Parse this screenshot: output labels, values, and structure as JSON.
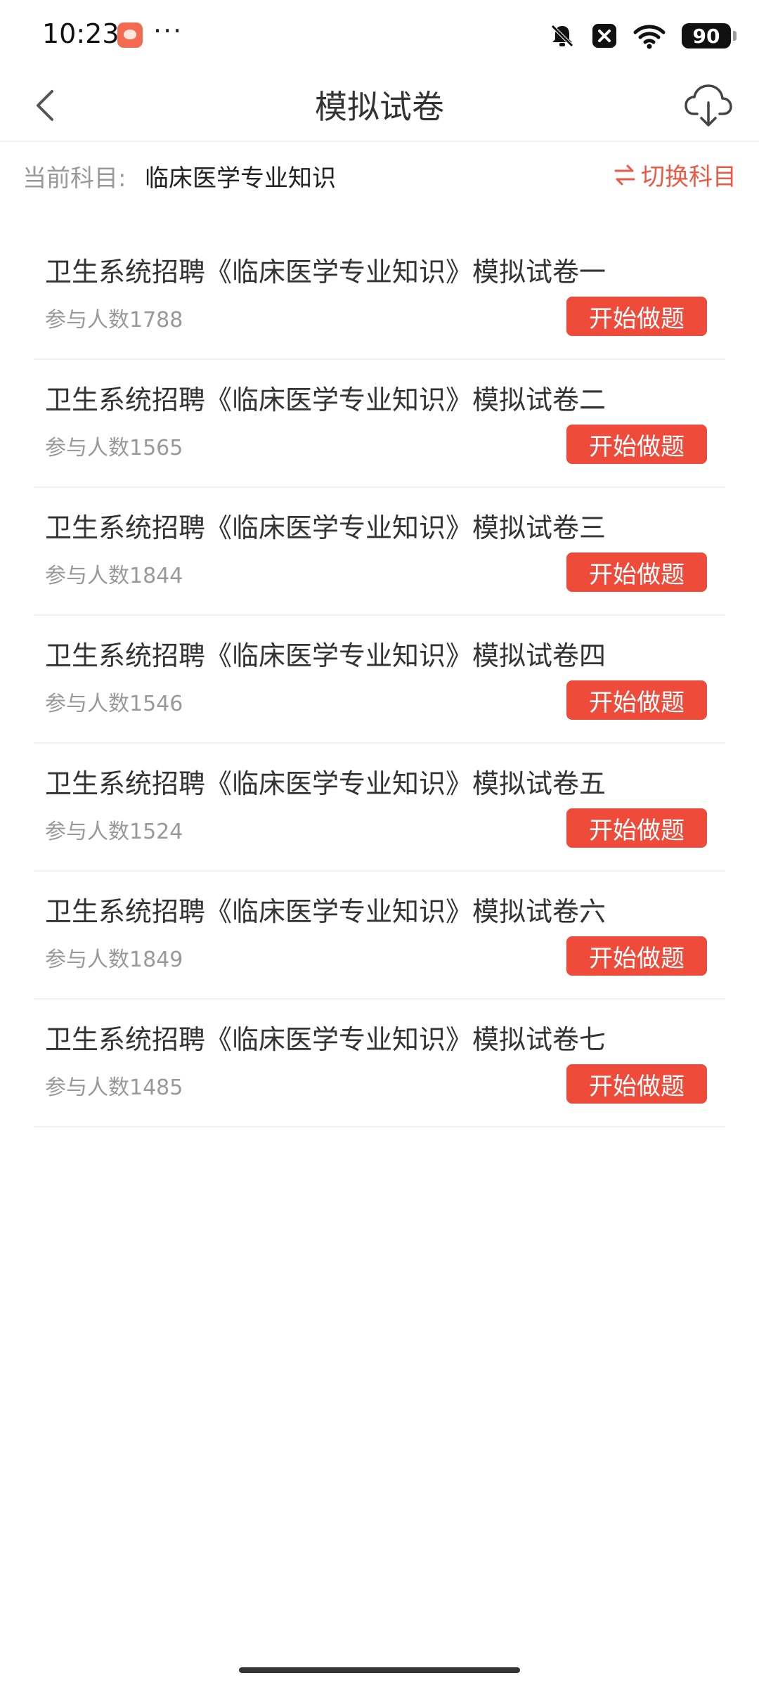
{
  "status_bar": {
    "time": "10:23",
    "dots": "···",
    "battery": "90",
    "icons": [
      "app-notification-icon",
      "mute-icon",
      "close-box-icon",
      "wifi-icon",
      "battery-icon"
    ]
  },
  "header": {
    "title": "模拟试卷",
    "back_icon": "chevron-left-icon",
    "download_icon": "cloud-download-icon"
  },
  "subject": {
    "label": "当前科目:",
    "value": "临床医学专业知识",
    "switch_label": "切换科目",
    "switch_icon": "swap-icon"
  },
  "exams": [
    {
      "title": "卫生系统招聘《临床医学专业知识》模拟试卷一",
      "count": "参与人数1788",
      "button": "开始做题"
    },
    {
      "title": "卫生系统招聘《临床医学专业知识》模拟试卷二",
      "count": "参与人数1565",
      "button": "开始做题"
    },
    {
      "title": "卫生系统招聘《临床医学专业知识》模拟试卷三",
      "count": "参与人数1844",
      "button": "开始做题"
    },
    {
      "title": "卫生系统招聘《临床医学专业知识》模拟试卷四",
      "count": "参与人数1546",
      "button": "开始做题"
    },
    {
      "title": "卫生系统招聘《临床医学专业知识》模拟试卷五",
      "count": "参与人数1524",
      "button": "开始做题"
    },
    {
      "title": "卫生系统招聘《临床医学专业知识》模拟试卷六",
      "count": "参与人数1849",
      "button": "开始做题"
    },
    {
      "title": "卫生系统招聘《临床医学专业知识》模拟试卷七",
      "count": "参与人数1485",
      "button": "开始做题"
    }
  ],
  "colors": {
    "accent": "#ef4b3b",
    "switch_text": "#ea5a45",
    "muted_text": "#999999",
    "primary_text": "#333333"
  }
}
